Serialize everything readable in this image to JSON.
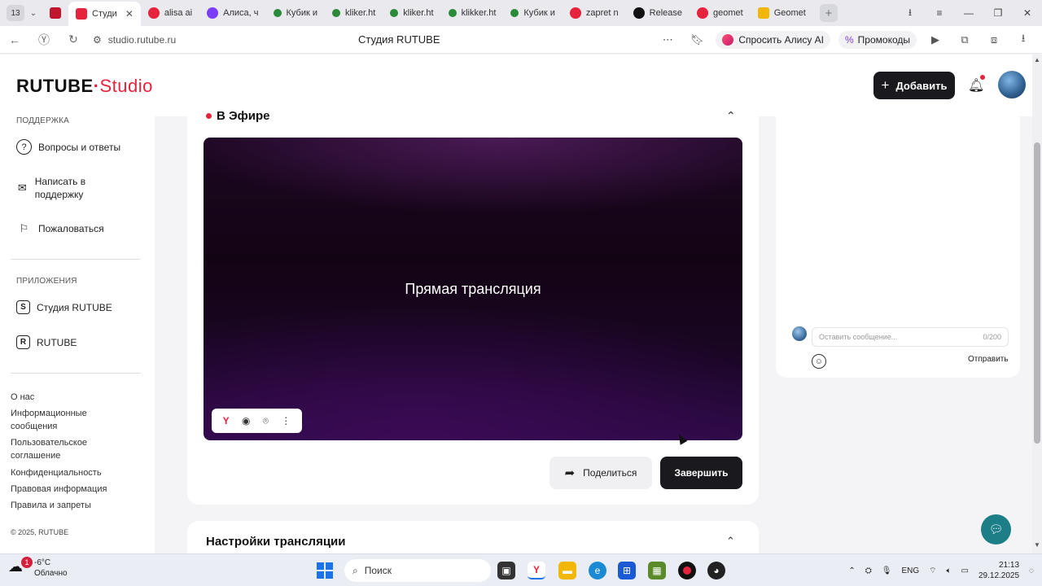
{
  "browser": {
    "tab_counter": "13",
    "tabs": [
      {
        "label": "",
        "favicon_color": "#c0162f",
        "active": false
      },
      {
        "label": "Студи",
        "favicon_color": "#e6233c",
        "active": true
      },
      {
        "label": "alisa ai",
        "favicon_color": "#e6233c",
        "active": false
      },
      {
        "label": "Алиса, ч",
        "favicon_color": "#7a3cff",
        "active": false
      },
      {
        "label": "Кубик и",
        "favicon_color": "#2a8a3a",
        "active": false
      },
      {
        "label": "kliker.ht",
        "favicon_color": "#2a8a3a",
        "active": false
      },
      {
        "label": "kliker.ht",
        "favicon_color": "#2a8a3a",
        "active": false
      },
      {
        "label": "klikker.ht",
        "favicon_color": "#2a8a3a",
        "active": false
      },
      {
        "label": "Кубик и",
        "favicon_color": "#2a8a3a",
        "active": false
      },
      {
        "label": "zapret n",
        "favicon_color": "#e6233c",
        "active": false
      },
      {
        "label": "Release",
        "favicon_color": "#111111",
        "active": false
      },
      {
        "label": "geomet",
        "favicon_color": "#e6233c",
        "active": false
      },
      {
        "label": "Geomet",
        "favicon_color": "#f2b705",
        "active": false
      }
    ],
    "url": "studio.rutube.ru",
    "page_title": "Студия RUTUBE",
    "ask_alice_label": "Спросить Алису AI",
    "promo_label": "Промокоды"
  },
  "header": {
    "logo_text": "RUTUBE",
    "logo_dot": "·",
    "logo_studio": "Studio",
    "add_button_label": "Добавить"
  },
  "sidebar": {
    "support_section": "ПОДДЕРЖКА",
    "support_items": [
      {
        "label": "Вопросы и ответы",
        "icon": "question-icon"
      },
      {
        "label": "Написать в поддержку",
        "icon": "mail-icon"
      },
      {
        "label": "Пожаловаться",
        "icon": "flag-icon"
      }
    ],
    "apps_section": "ПРИЛОЖЕНИЯ",
    "app_items": [
      {
        "label": "Студия RUTUBE",
        "icon": "studio-app-icon"
      },
      {
        "label": "RUTUBE",
        "icon": "rutube-app-icon"
      }
    ],
    "footer_links": [
      "О нас",
      "Информационные сообщения",
      "Пользовательское соглашение",
      "Конфиденциальность",
      "Правовая информация",
      "Правила и запреты"
    ],
    "copyright": "© 2025, RUTUBE"
  },
  "stream": {
    "status_label": "В Эфире",
    "player_title": "Прямая трансляция",
    "share_label": "Поделиться",
    "finish_label": "Завершить"
  },
  "settings": {
    "title": "Настройки трансляции"
  },
  "chat": {
    "placeholder": "Оставить сообщение...",
    "counter": "0/200",
    "send_label": "Отправить"
  },
  "taskbar": {
    "weather_badge": "1",
    "temperature": "-6°C",
    "weather_text": "Облачно",
    "search_label": "Поиск",
    "language": "ENG",
    "time": "21:13",
    "date": "29.12.2025"
  },
  "colors": {
    "accent_red": "#e6233c",
    "dark_button": "#1a1a1e",
    "support_fab": "#1c7f88"
  }
}
